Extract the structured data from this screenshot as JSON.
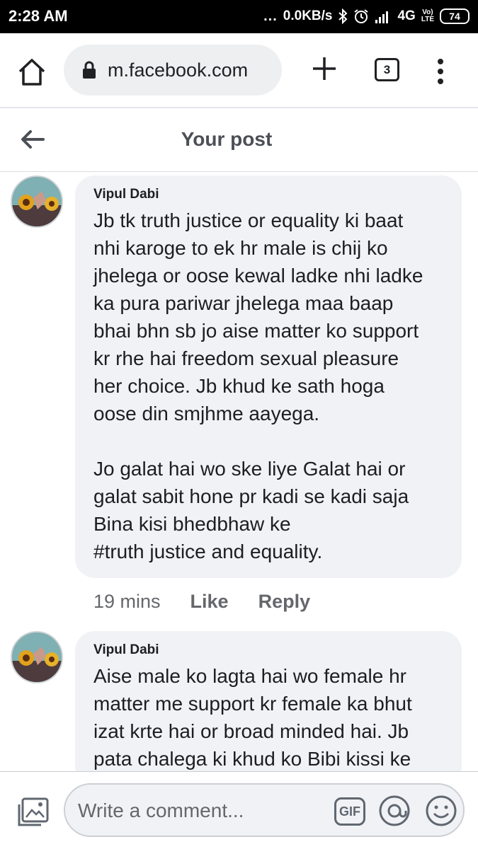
{
  "status_bar": {
    "time": "2:28 AM",
    "dots": "...",
    "network_speed": "0.0KB/s",
    "network_type": "4G",
    "volte_line1": "Vo)",
    "volte_line2": "LTE",
    "battery": "74",
    "icons": [
      "bluetooth-icon",
      "alarm-icon",
      "signal-icon",
      "volte-icon",
      "battery-icon"
    ]
  },
  "browser": {
    "url": "m.facebook.com",
    "tab_count": "3",
    "icons": [
      "home-icon",
      "lock-icon",
      "plus-icon",
      "more-vert-icon"
    ]
  },
  "header": {
    "title": "Your post",
    "back_icon": "arrow-left-icon"
  },
  "comments": [
    {
      "author": "Vipul Dabi",
      "text": "Jb tk truth justice or equality ki baat\nnhi karoge    to ek hr male is chij ko\njhelega or oose kewal ladke nhi ladke\nka pura pariwar jhelega maa baap\nbhai bhn sb jo aise matter ko support\nkr rhe hai freedom sexual pleasure\nher choice. Jb khud ke sath hoga\noose din smjhme aayega.\n\nJo galat hai wo ske liye Galat hai or\ngalat sabit hone pr kadi se kadi saja\nBina kisi bhedbhaw ke\n#truth justice and equality.",
      "time": "19 mins",
      "like_label": "Like",
      "reply_label": "Reply"
    },
    {
      "author": "Vipul Dabi",
      "text": "Aise male ko lagta hai wo female hr\nmatter me support kr female ka bhut\nizat krte hai or broad minded hai. Jb\npata chalega ki khud ko Bibi kissi ke"
    }
  ],
  "composer": {
    "placeholder": "Write a comment...",
    "gif_label": "GIF",
    "icons": [
      "photo-icon",
      "gif-icon",
      "sticker-icon",
      "emoji-icon"
    ]
  },
  "colors": {
    "bubble": "#f0f2f5",
    "meta_text": "#65676b",
    "status_bar": "#000000"
  }
}
